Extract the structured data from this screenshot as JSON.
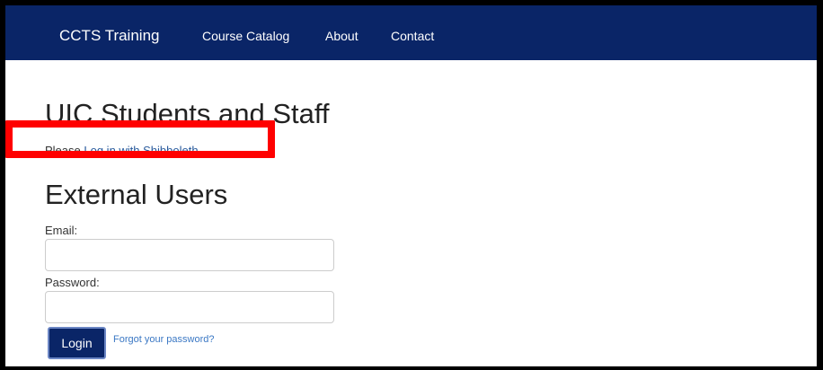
{
  "navbar": {
    "brand": "CCTS Training",
    "links": [
      "Course Catalog",
      "About",
      "Contact"
    ],
    "background_color": "#0a2567"
  },
  "uic_section": {
    "heading": "UIC Students and Staff",
    "prefix_text": "Please ",
    "link_text": "Log in with Shibboleth",
    "suffix_text": "."
  },
  "external_section": {
    "heading": "External Users",
    "email_label": "Email:",
    "email_value": "",
    "password_label": "Password:",
    "password_value": "",
    "login_button": "Login",
    "forgot_link": "Forgot your password?"
  },
  "annotation": {
    "highlight_color": "#ff0000"
  }
}
